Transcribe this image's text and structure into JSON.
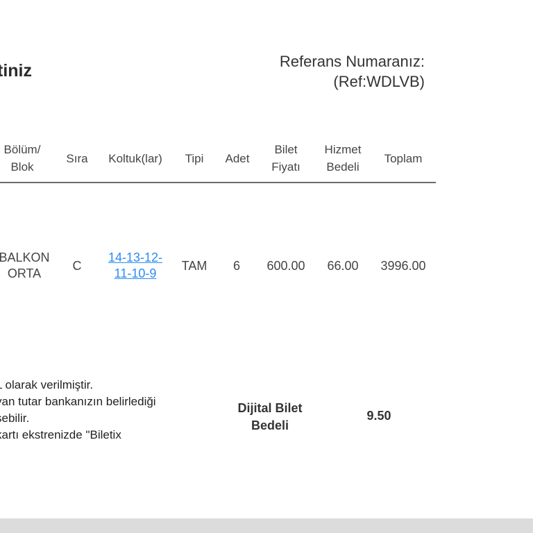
{
  "heading": "tiniz",
  "reference": {
    "label": "Referans Numaranız:",
    "value": "(Ref:WDLVB)"
  },
  "table": {
    "headers": {
      "section": [
        "Bölüm/",
        "Blok"
      ],
      "row": "Sıra",
      "seats": "Koltuk(lar)",
      "type": "Tipi",
      "quantity": "Adet",
      "ticket_price": [
        "Bilet",
        "Fiyatı"
      ],
      "service_fee": [
        "Hizmet",
        "Bedeli"
      ],
      "total": "Toplam"
    },
    "rows": [
      {
        "section": [
          "BALKON",
          "ORTA"
        ],
        "row": "C",
        "seats": [
          "14-13-12-",
          "11-10-9"
        ],
        "type": "TAM",
        "quantity": "6",
        "ticket_price": "600.00",
        "service_fee": "66.00",
        "total": "3996.00"
      }
    ]
  },
  "notes": [
    "L olarak verilmiştir.",
    "yan tutar bankanızın belirlediği",
    "şebilir.",
    "kartı ekstrenizde \"Biletix"
  ],
  "digital_fee": {
    "label": [
      "Dijital Bilet",
      "Bedeli"
    ],
    "value": "9.50"
  }
}
